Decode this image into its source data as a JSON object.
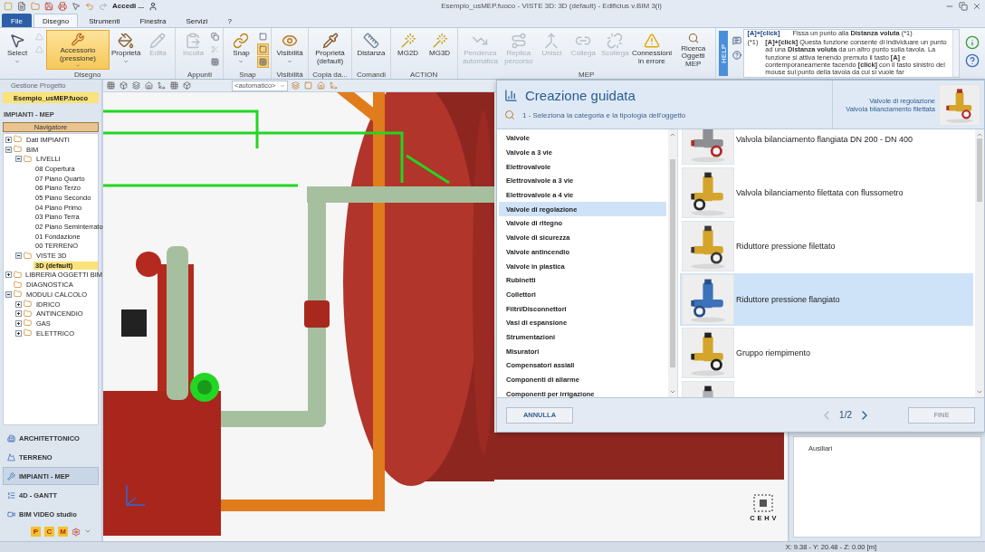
{
  "title_bar": {
    "account": "Accedi ...",
    "title": "Esempio_usMEP.fuoco - VISTE 3D: 3D (default) - Edificius v.BIM 3(i)"
  },
  "menu_tabs": [
    {
      "label": "File",
      "kind": "application",
      "selected": false
    },
    {
      "label": "Disegno",
      "kind": "tab",
      "selected": true
    },
    {
      "label": "Strumenti",
      "kind": "tab",
      "selected": false
    },
    {
      "label": "Finestra",
      "kind": "tab",
      "selected": false
    },
    {
      "label": "Servizi",
      "kind": "tab",
      "selected": false
    },
    {
      "label": "?",
      "kind": "tab",
      "selected": false
    }
  ],
  "ribbon": {
    "groups": [
      {
        "label": "Disegno",
        "buttons": [
          {
            "kind": "large",
            "label": "Select",
            "dropdown": true,
            "active": false,
            "disabled": false
          },
          {
            "kind": "stack",
            "items": [
              {
                "active": false,
                "disabled": true
              },
              {
                "active": false,
                "disabled": true
              }
            ]
          },
          {
            "kind": "large",
            "label": "Accessorio (pressione)",
            "dropdown": true,
            "active": true,
            "disabled": false
          },
          {
            "kind": "large",
            "label": "Proprietà",
            "dropdown": true,
            "active": false,
            "disabled": false
          },
          {
            "kind": "large",
            "label": "Edita",
            "dropdown": false,
            "active": false,
            "disabled": true
          }
        ]
      },
      {
        "label": "Appunti",
        "buttons": [
          {
            "kind": "large",
            "label": "Incolla",
            "dropdown": false,
            "active": false,
            "disabled": true
          },
          {
            "kind": "stack",
            "items": [
              {
                "active": false,
                "disabled": false
              },
              {
                "active": false,
                "disabled": true
              },
              {
                "active": false,
                "disabled": false
              }
            ]
          }
        ]
      },
      {
        "label": "Snap",
        "buttons": [
          {
            "kind": "large",
            "label": "Snap",
            "dropdown": true,
            "active": false,
            "disabled": false
          },
          {
            "kind": "stack",
            "items": [
              {
                "active": false,
                "disabled": false
              },
              {
                "active": true,
                "disabled": false
              },
              {
                "active": true,
                "disabled": false
              }
            ]
          }
        ]
      },
      {
        "label": "Visibilità",
        "buttons": [
          {
            "kind": "large",
            "label": "Visibilità",
            "dropdown": true,
            "active": false,
            "disabled": false
          }
        ]
      },
      {
        "label": "Copia da...",
        "buttons": [
          {
            "kind": "large",
            "label": "Proprietà (default)",
            "dropdown": false,
            "active": false,
            "disabled": false
          }
        ]
      },
      {
        "label": "Comandi",
        "buttons": [
          {
            "kind": "large",
            "label": "Distanza",
            "dropdown": false,
            "active": false,
            "disabled": false
          }
        ]
      },
      {
        "label": "ACTION",
        "buttons": [
          {
            "kind": "large",
            "label": "MG2D",
            "dropdown": false,
            "active": false,
            "disabled": false
          },
          {
            "kind": "large",
            "label": "MG3D",
            "dropdown": false,
            "active": false,
            "disabled": false
          }
        ]
      },
      {
        "label": "MEP",
        "buttons": [
          {
            "kind": "large",
            "label": "Pendenza automatica",
            "dropdown": false,
            "active": false,
            "disabled": true
          },
          {
            "kind": "large",
            "label": "Replica percorso",
            "dropdown": false,
            "active": false,
            "disabled": true
          },
          {
            "kind": "large",
            "label": "Unisci",
            "dropdown": false,
            "active": false,
            "disabled": true
          },
          {
            "kind": "large",
            "label": "Collega",
            "dropdown": false,
            "active": false,
            "disabled": true
          },
          {
            "kind": "large",
            "label": "Scollega",
            "dropdown": false,
            "active": false,
            "disabled": true
          },
          {
            "kind": "large",
            "label": "Connessioni in errore",
            "dropdown": false,
            "active": false,
            "disabled": false
          },
          {
            "kind": "large",
            "label": "Ricerca Oggetti MEP",
            "dropdown": false,
            "active": false,
            "disabled": false
          }
        ]
      }
    ]
  },
  "help": {
    "tab": "HELP",
    "shortcut_key": "[A]+[click]",
    "shortcut_text": "Fissa un punto alla **Distanza voluta** (*1)",
    "note_mark": "(*1)",
    "note_text": "**[A]+[click]** Questa funzione consente di individuare un punto ad una **Distanza voluta** da un altro punto sulla tavola. La funzione si attiva tenendo premuto il tasto **[A]** e contemporaneamente facendo **[click]** con il tasto sinistro del mouse sul punto della tavola da cui si vuole far"
  },
  "project_panel": {
    "title": "Gestione Progetto",
    "file": "Esempio_usMEP.fuoco",
    "section": "IMPIANTI - MEP",
    "navigator": "Navigatore",
    "tree": [
      {
        "label": "Dati IMPIANTI",
        "expanded": false,
        "selected": false
      },
      {
        "label": "BIM",
        "expanded": true,
        "selected": false,
        "children": [
          {
            "label": "LIVELLI",
            "expanded": true,
            "selected": false,
            "children": [
              {
                "label": "08 Copertura",
                "selected": false
              },
              {
                "label": "07 Piano Quarto",
                "selected": false
              },
              {
                "label": "06 Piano Terzo",
                "selected": false
              },
              {
                "label": "05 Piano Secondo",
                "selected": false
              },
              {
                "label": "04 Piano Primo",
                "selected": false
              },
              {
                "label": "03 Piano Terra",
                "selected": false
              },
              {
                "label": "02 Piano Seminterrato",
                "selected": false
              },
              {
                "label": "01 Fondazione",
                "selected": false
              },
              {
                "label": "00 TERRENO",
                "selected": false
              }
            ]
          },
          {
            "label": "VISTE 3D",
            "expanded": true,
            "selected": false,
            "children": [
              {
                "label": "3D (default)",
                "selected": true
              }
            ]
          }
        ]
      },
      {
        "label": "LIBRERIA OGGETTI BIM",
        "expanded": false,
        "selected": false
      },
      {
        "label": "DIAGNOSTICA",
        "selected": false
      },
      {
        "label": "MODULI CALCOLO",
        "expanded": true,
        "selected": false,
        "children": [
          {
            "label": "IDRICO",
            "expanded": false,
            "selected": false
          },
          {
            "label": "ANTINCENDIO",
            "expanded": false,
            "selected": false
          },
          {
            "label": "GAS",
            "expanded": false,
            "selected": false
          },
          {
            "label": "ELETTRICO",
            "expanded": false,
            "selected": false
          }
        ]
      }
    ],
    "modules": [
      {
        "label": "ARCHITETTONICO",
        "selected": false
      },
      {
        "label": "TERRENO",
        "selected": false
      },
      {
        "label": "IMPIANTI - MEP",
        "selected": true
      },
      {
        "label": "4D - GANTT",
        "selected": false
      },
      {
        "label": "BIM VIDEO studio",
        "selected": false
      }
    ],
    "module_keys": [
      "P",
      "C",
      "M"
    ]
  },
  "view_toolbar": {
    "view_select": "<automatico>"
  },
  "wizard": {
    "title": "Creazione guidata",
    "step": "1 - Seleziona la categoria e la tipologia dell'oggetto",
    "current_category": "Valvole di regolazione",
    "current_item": "Valvola bilanciamento filettata",
    "categories": [
      {
        "label": "Valvole",
        "selected": false
      },
      {
        "label": "Valvole a 3 vie",
        "selected": false
      },
      {
        "label": "Elettrovalvole",
        "selected": false
      },
      {
        "label": "Elettrovalvole a 3 vie",
        "selected": false
      },
      {
        "label": "Elettrovalvole a 4 vie",
        "selected": false
      },
      {
        "label": "Valvole di regolazione",
        "selected": true
      },
      {
        "label": "Valvole di ritegno",
        "selected": false
      },
      {
        "label": "Valvole di sicurezza",
        "selected": false
      },
      {
        "label": "Valvole antincendio",
        "selected": false
      },
      {
        "label": "Valvole in plastica",
        "selected": false
      },
      {
        "label": "Rubinetti",
        "selected": false
      },
      {
        "label": "Collettori",
        "selected": false
      },
      {
        "label": "Filtri/Disconnettori",
        "selected": false
      },
      {
        "label": "Vasi di espansione",
        "selected": false
      },
      {
        "label": "Strumentazioni",
        "selected": false
      },
      {
        "label": "Misuratori",
        "selected": false
      },
      {
        "label": "Compensatori assiali",
        "selected": false
      },
      {
        "label": "Componenti di allarme",
        "selected": false
      },
      {
        "label": "Componenti per irrigazione",
        "selected": false
      }
    ],
    "items": [
      {
        "label": "Valvola bilanciamento flangiata DN 200 - DN 400",
        "selected": false
      },
      {
        "label": "Valvola bilanciamento filettata con flussometro",
        "selected": false
      },
      {
        "label": "Riduttore pressione filettato",
        "selected": false
      },
      {
        "label": "Riduttore pressione flangiato",
        "selected": true
      },
      {
        "label": "Gruppo riempimento",
        "selected": false
      },
      {
        "selected": false
      }
    ],
    "cancel": "ANNULLA",
    "page": "1/2",
    "prev_disabled": true,
    "finish": "FINE",
    "finish_disabled": true
  },
  "side_panel": {
    "label": "Ausiliari"
  },
  "view_cube": [
    "C",
    "E",
    "H",
    "V"
  ],
  "status_bar": {
    "coordinates": "X: 9.38 - Y: 20.48 - Z: 0.00 [m]"
  }
}
